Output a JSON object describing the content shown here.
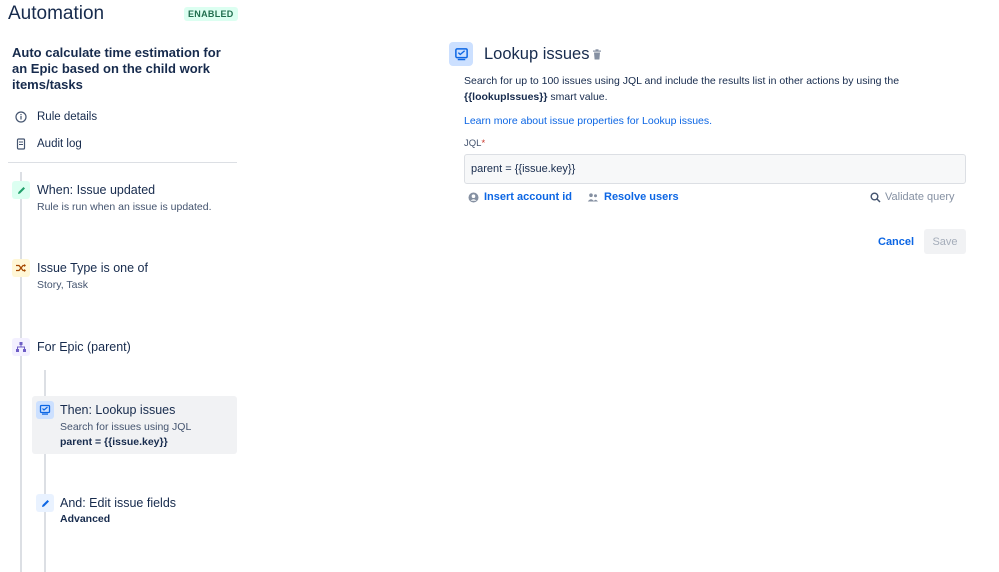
{
  "header": {
    "title": "Automation",
    "status_badge": "ENABLED"
  },
  "sidebar": {
    "rule_name": "Auto calculate time estimation for an Epic based on the child work items/tasks",
    "links": [
      {
        "label": "Rule details",
        "icon": "info-icon"
      },
      {
        "label": "Audit log",
        "icon": "document-icon"
      }
    ],
    "steps": [
      {
        "title": "When: Issue updated",
        "subtitle": "Rule is run when an issue is updated.",
        "icon": "pencil-icon",
        "icon_bg": "#dcfff1",
        "icon_color": "#22a06b"
      },
      {
        "title": "Issue Type is one of",
        "subtitle": "Story, Task",
        "icon": "shuffle-icon",
        "icon_bg": "#fff7d6",
        "icon_color": "#a54800"
      },
      {
        "title": "For Epic (parent)",
        "icon": "hierarchy-icon",
        "icon_bg": "#f3f0ff",
        "icon_color": "#6e5dc6"
      },
      {
        "title": "Then: Lookup issues",
        "subtitle": "Search for issues using JQL",
        "detail": "parent = {{issue.key}}",
        "icon": "lookup-icon",
        "icon_bg": "#cce0ff",
        "icon_color": "#0c66e4"
      },
      {
        "title": "And: Edit issue fields",
        "detail": "Advanced",
        "icon": "pencil-icon",
        "icon_bg": "#e9f2ff",
        "icon_color": "#0c66e4"
      }
    ]
  },
  "panel": {
    "title": "Lookup issues",
    "description_line1": "Search for up to 100 issues using JQL and include the results list in other actions by using the",
    "description_smart_value": "{{lookupIssues}}",
    "description_suffix": " smart value.",
    "learn_more": "Learn more about issue properties for Lookup issues.",
    "jql_label": "JQL",
    "required_mark": "*",
    "jql_value": "parent = {{issue.key}}",
    "insert_account_id": "Insert account id",
    "resolve_users": "Resolve users",
    "validate_query": "Validate query",
    "cancel": "Cancel",
    "save": "Save"
  },
  "colors": {
    "accent": "#0c66e4",
    "text": "#172b4d",
    "subtle_text": "#44546f",
    "enabled_badge_bg": "#dcfff1",
    "enabled_badge_text": "#216e4e"
  }
}
